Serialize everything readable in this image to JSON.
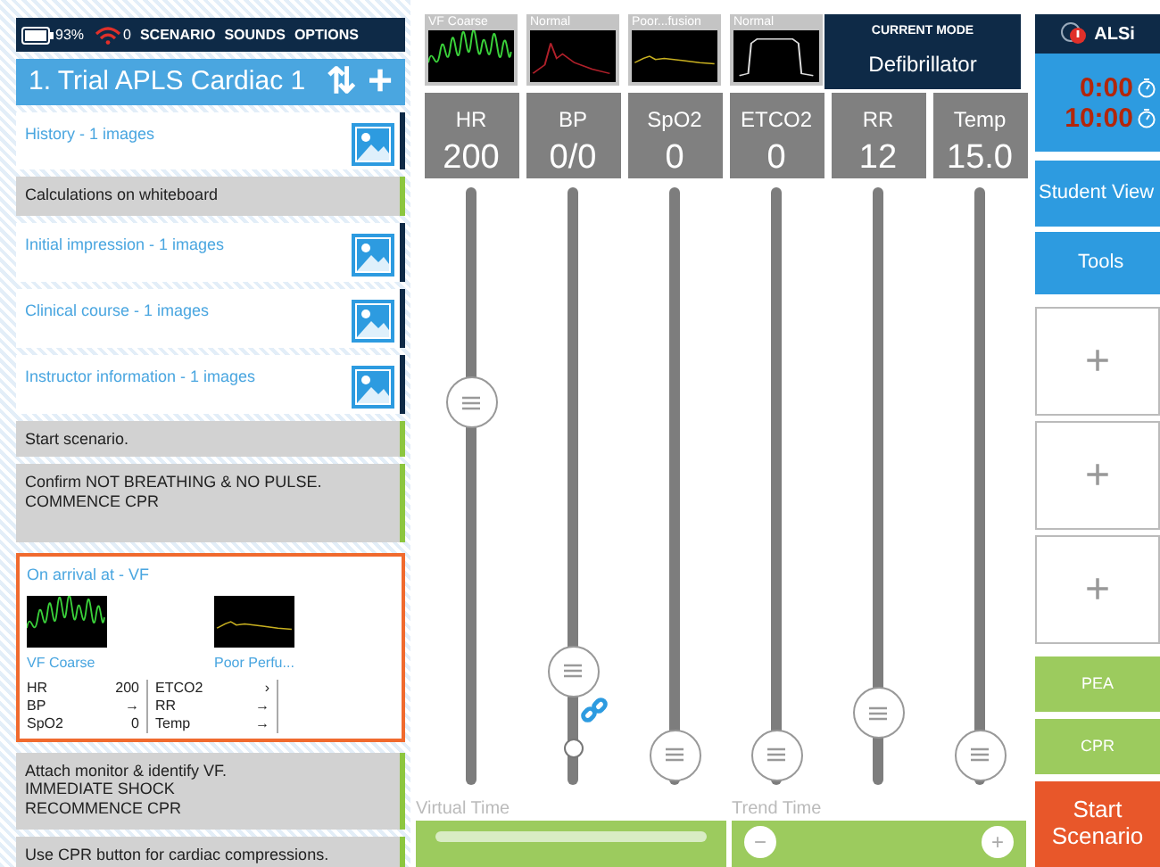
{
  "status_bar": {
    "battery": "93%",
    "signal": "0",
    "menu": [
      "SCENARIO",
      "SOUNDS",
      "OPTIONS"
    ]
  },
  "scenario": {
    "title": "1. Trial APLS Cardiac 1",
    "sort": "⇅",
    "add": "+"
  },
  "items": [
    {
      "kind": "image",
      "text": "History - 1 images"
    },
    {
      "kind": "note",
      "text": "Calculations on whiteboard"
    },
    {
      "kind": "image",
      "text": "Initial impression - 1 images"
    },
    {
      "kind": "image",
      "text": "Clinical course - 1 images"
    },
    {
      "kind": "image",
      "text": "Instructor information - 1 images"
    },
    {
      "kind": "note",
      "text": "Start scenario."
    },
    {
      "kind": "note",
      "text": "Confirm NOT BREATHING & NO PULSE.\nCOMMENCE CPR"
    },
    {
      "kind": "state",
      "text": "On arrival at - VF",
      "selected": true,
      "monitors": [
        {
          "label": "VF Coarse",
          "kind": "vf"
        },
        {
          "label": "Poor Perfu...",
          "kind": "pleth"
        }
      ],
      "vitals_left": [
        {
          "name": "HR",
          "value": "200"
        },
        {
          "name": "BP",
          "value": "→"
        },
        {
          "name": "SpO2",
          "value": "0"
        }
      ],
      "vitals_right": [
        {
          "name": "ETCO2",
          "value": "›"
        },
        {
          "name": "RR",
          "value": "→"
        },
        {
          "name": "Temp",
          "value": "→"
        }
      ]
    },
    {
      "kind": "note",
      "text": "Attach monitor & identify VF.\nIMMEDIATE  SHOCK\nRECOMMENCE CPR"
    },
    {
      "kind": "note",
      "text": "Use CPR button for cardiac compressions."
    }
  ],
  "channels": [
    {
      "label": "HR",
      "value": "200",
      "waveform_label": "VF Coarse",
      "kind": "vf",
      "level": 0.64
    },
    {
      "label": "BP",
      "value": "0/0",
      "waveform_label": "Normal",
      "kind": "arterial",
      "level": 0.19,
      "linked": {
        "level": 0.06
      }
    },
    {
      "label": "SpO2",
      "value": "0",
      "waveform_label": "Poor...fusion",
      "kind": "pleth",
      "level": 0.05
    },
    {
      "label": "ETCO2",
      "value": "0",
      "waveform_label": "Normal",
      "kind": "capno",
      "level": 0.05
    },
    {
      "label": "RR",
      "value": "12",
      "level": 0.12
    },
    {
      "label": "Temp",
      "value": "15.0",
      "level": 0.05
    }
  ],
  "current_mode": {
    "heading": "CURRENT MODE",
    "value": "Defibrillator"
  },
  "virtual_time": {
    "label": "Virtual Time"
  },
  "trend_time": {
    "label": "Trend Time",
    "minus": "−",
    "plus": "+"
  },
  "right_panel": {
    "logo": "ALSi",
    "elapsed": "0:00",
    "countdown": "10:00",
    "buttons": [
      "Student View",
      "Tools"
    ],
    "slots": [
      "+",
      "+",
      "+"
    ],
    "actions": [
      "PEA",
      "CPR"
    ],
    "start": "Start Scenario"
  }
}
